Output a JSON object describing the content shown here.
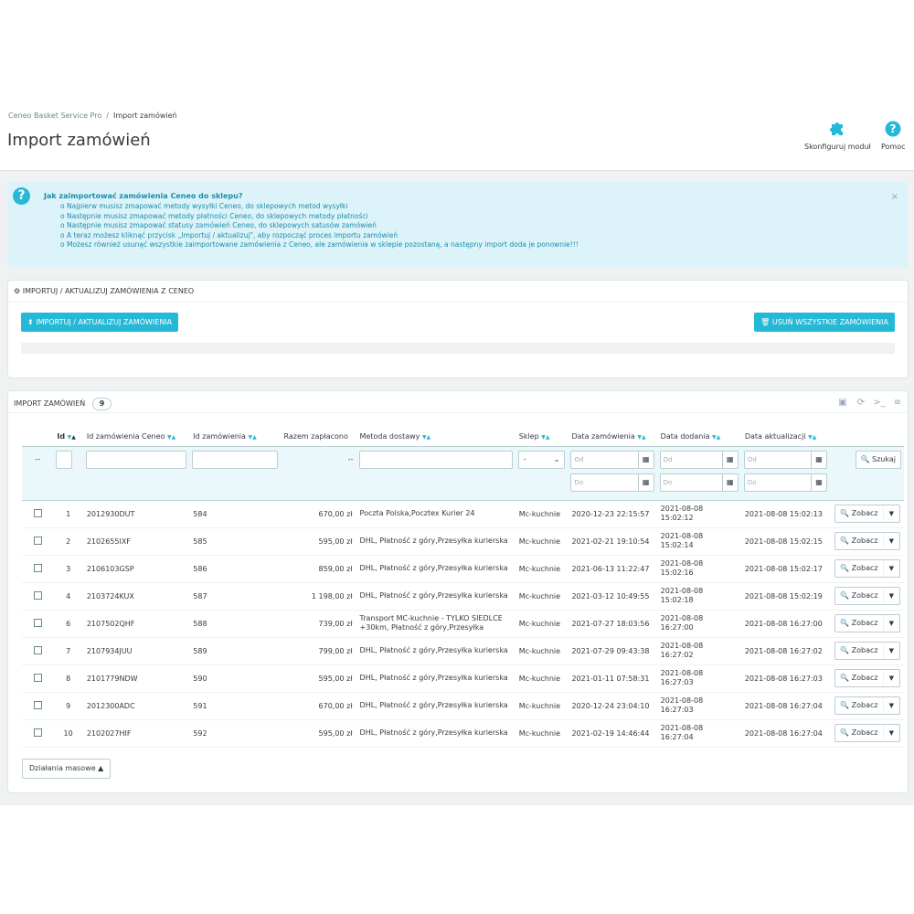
{
  "breadcrumb": {
    "parent": "Ceneo Basket Service Pro",
    "separator": "/",
    "current": "Import zamówień"
  },
  "page_title": "Import zamówień",
  "toolbar": {
    "configure_label": "Skonfiguruj moduł",
    "help_label": "Pomoc"
  },
  "alert": {
    "title": "Jak zaimportować zamówienia Ceneo do sklepu?",
    "items": [
      "Najpierw musisz zmapować metody wysyłki Ceneo, do sklepowych metod wysyłki",
      "Następnie musisz zmapować metody płatności Ceneo, do sklepowych metody płatności",
      "Następnie musisz zmapować statusy zamówień Ceneo, do sklepowych satusów zamówień",
      "A teraz możesz kliknąć przycisk „Importuj / aktualizuj\", aby rozpocząć proces importu zamówień",
      "Możesz również usunąć wszystkie zaimportowane zamówienia z Ceneo, ale zamówienia w sklepie pozostaną, a następny import doda je ponownie!!!"
    ],
    "close": "×"
  },
  "import_panel": {
    "heading": "IMPORTUJ / AKTUALIZUJ ZAMÓWIENIA Z CENEO",
    "import_button": "IMPORTUJ / AKTUALIZUJ ZAMÓWIENIA",
    "delete_button": "USUŃ WSZYSTKIE ZAMÓWIENIA"
  },
  "orders_panel": {
    "heading": "IMPORT ZAMÓWIEŃ",
    "count": "9",
    "columns": [
      "Id",
      "Id zamówienia Ceneo",
      "Id zamówienia",
      "Razem zapłacono",
      "Metoda dostawy",
      "Sklep",
      "Data zamówienia",
      "Data dodania",
      "Data aktualizacji"
    ],
    "filter": {
      "dash1": "--",
      "dash2": "--",
      "shop_select": "-",
      "from_placeholder": "Od",
      "to_placeholder": "Do",
      "search_button": "Szukaj"
    },
    "rows": [
      {
        "id": "1",
        "ceneo_id": "2012930DUT",
        "order_id": "584",
        "total": "670,00 zł",
        "delivery": "Poczta Polska,Pocztex Kurier 24",
        "delivery2": "",
        "shop": "Mc-kuchnie",
        "order_date": "2020-12-23 22:15:57",
        "added_date": "2021-08-08",
        "added_time": "15:02:12",
        "updated": "2021-08-08 15:02:13"
      },
      {
        "id": "2",
        "ceneo_id": "2102655IXF",
        "order_id": "585",
        "total": "595,00 zł",
        "delivery": "DHL, Płatność z góry,Przesyłka kurierska",
        "delivery2": "",
        "shop": "Mc-kuchnie",
        "order_date": "2021-02-21 19:10:54",
        "added_date": "2021-08-08",
        "added_time": "15:02:14",
        "updated": "2021-08-08 15:02:15"
      },
      {
        "id": "3",
        "ceneo_id": "2106103GSP",
        "order_id": "586",
        "total": "859,00 zł",
        "delivery": "DHL, Płatność z góry,Przesyłka kurierska",
        "delivery2": "",
        "shop": "Mc-kuchnie",
        "order_date": "2021-06-13 11:22:47",
        "added_date": "2021-08-08",
        "added_time": "15:02:16",
        "updated": "2021-08-08 15:02:17"
      },
      {
        "id": "4",
        "ceneo_id": "2103724KUX",
        "order_id": "587",
        "total": "1 198,00 zł",
        "delivery": "DHL, Płatność z góry,Przesyłka kurierska",
        "delivery2": "",
        "shop": "Mc-kuchnie",
        "order_date": "2021-03-12 10:49:55",
        "added_date": "2021-08-08",
        "added_time": "15:02:18",
        "updated": "2021-08-08 15:02:19"
      },
      {
        "id": "6",
        "ceneo_id": "2107502QHF",
        "order_id": "588",
        "total": "739,00 zł",
        "delivery": "Transport MC-kuchnie - TYLKO SIEDLCE",
        "delivery2": "+30km, Płatność z góry,Przesyłka",
        "shop": "Mc-kuchnie",
        "order_date": "2021-07-27 18:03:56",
        "added_date": "2021-08-08",
        "added_time": "16:27:00",
        "updated": "2021-08-08 16:27:00"
      },
      {
        "id": "7",
        "ceneo_id": "2107934JUU",
        "order_id": "589",
        "total": "799,00 zł",
        "delivery": "DHL, Płatność z góry,Przesyłka kurierska",
        "delivery2": "",
        "shop": "Mc-kuchnie",
        "order_date": "2021-07-29 09:43:38",
        "added_date": "2021-08-08",
        "added_time": "16:27:02",
        "updated": "2021-08-08 16:27:02"
      },
      {
        "id": "8",
        "ceneo_id": "2101779NDW",
        "order_id": "590",
        "total": "595,00 zł",
        "delivery": "DHL, Płatność z góry,Przesyłka kurierska",
        "delivery2": "",
        "shop": "Mc-kuchnie",
        "order_date": "2021-01-11 07:58:31",
        "added_date": "2021-08-08",
        "added_time": "16:27:03",
        "updated": "2021-08-08 16:27:03"
      },
      {
        "id": "9",
        "ceneo_id": "2012300ADC",
        "order_id": "591",
        "total": "670,00 zł",
        "delivery": "DHL, Płatność z góry,Przesyłka kurierska",
        "delivery2": "",
        "shop": "Mc-kuchnie",
        "order_date": "2020-12-24 23:04:10",
        "added_date": "2021-08-08",
        "added_time": "16:27:03",
        "updated": "2021-08-08 16:27:04"
      },
      {
        "id": "10",
        "ceneo_id": "2102027HIF",
        "order_id": "592",
        "total": "595,00 zł",
        "delivery": "DHL, Płatność z góry,Przesyłka kurierska",
        "delivery2": "",
        "shop": "Mc-kuchnie",
        "order_date": "2021-02-19 14:46:44",
        "added_date": "2021-08-08",
        "added_time": "16:27:04",
        "updated": "2021-08-08 16:27:04"
      }
    ],
    "view_button": "Zobacz",
    "bulk_actions": "Działania masowe"
  },
  "icons": [
    "puzzle-icon",
    "help-icon",
    "upload-icon",
    "trash-icon",
    "cogs-icon",
    "search-icon",
    "calendar-icon",
    "caret-down-icon"
  ],
  "colors": {
    "accent": "#25b9d7",
    "alert_bg": "#dcf4f9",
    "alert_text": "#1c8dab",
    "page_bg": "#eff1f2"
  }
}
